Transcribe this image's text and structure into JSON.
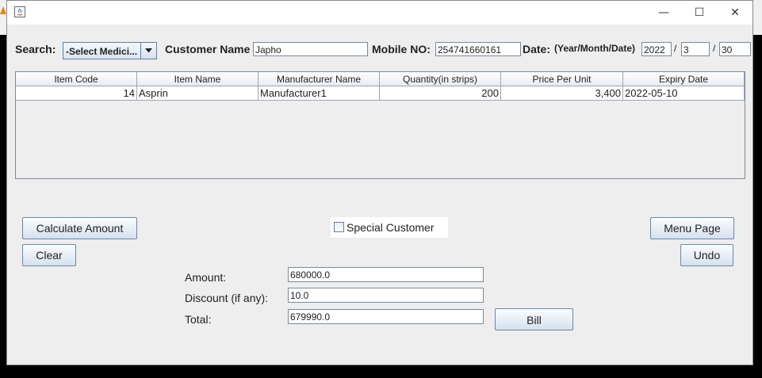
{
  "window": {
    "title": "",
    "controls": {
      "minimize": "—",
      "maximize": "☐",
      "close": "✕"
    }
  },
  "search": {
    "label": "Search:",
    "combo_selected": "-Select Medici..."
  },
  "customer": {
    "name_label": "Customer Name",
    "name_value": "Japho",
    "mobile_label": "Mobile NO:",
    "mobile_value": "254741660161",
    "date_label": "Date:",
    "date_format": "(Year/Month/Date)",
    "year": "2022",
    "month": "3",
    "day": "30",
    "separator": "/"
  },
  "table": {
    "columns": [
      "Item Code",
      "Item Name",
      "Manufacturer Name",
      "Quantity(in strips)",
      "Price Per Unit",
      "Expiry Date"
    ],
    "rows": [
      [
        "14",
        "Asprin",
        "Manufacturer1",
        "200",
        "3,400",
        "2022-05-10"
      ]
    ]
  },
  "buttons": {
    "calculate": "Calculate Amount",
    "clear": "Clear",
    "menu": "Menu Page",
    "undo": "Undo",
    "bill": "Bill"
  },
  "special_customer": {
    "label": "Special Customer",
    "checked": false
  },
  "summary": {
    "amount_label": "Amount:",
    "amount_value": "680000.0",
    "discount_label": "Discount (if any):",
    "discount_value": "10.0",
    "total_label": "Total:",
    "total_value": "679990.0"
  },
  "colors": {
    "window_bg": "#eeeeee",
    "button_border": "#6b87a8",
    "desktop": "#000000"
  }
}
